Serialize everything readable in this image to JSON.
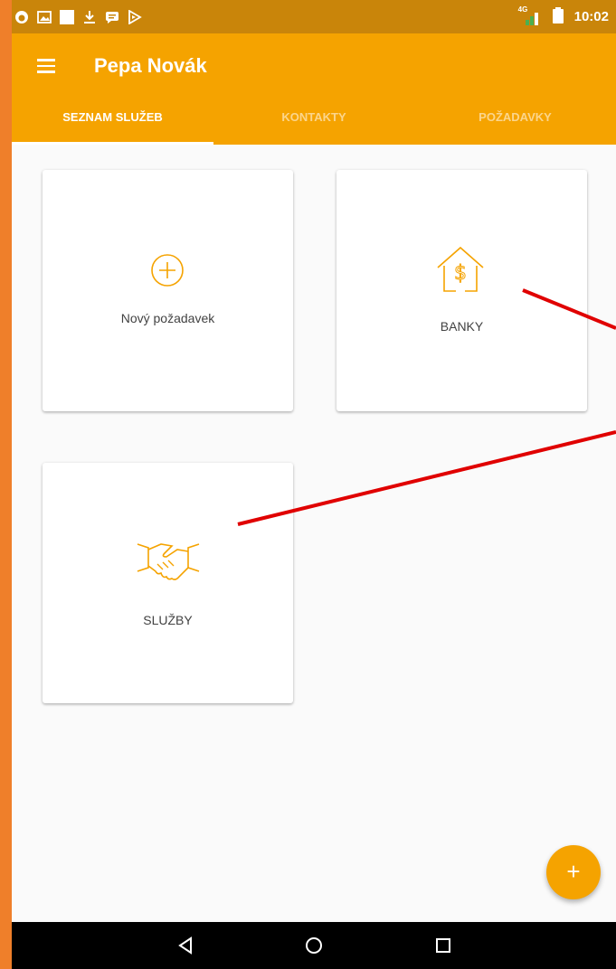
{
  "status_bar": {
    "network": "4G",
    "time": "10:02"
  },
  "app_bar": {
    "title": "Pepa Novák",
    "menu_icon": "hamburger-menu-icon"
  },
  "tabs": [
    {
      "label": "SEZNAM SLUŽEB",
      "active": true
    },
    {
      "label": "KONTAKTY",
      "active": false
    },
    {
      "label": "POŽADAVKY",
      "active": false
    }
  ],
  "cards": [
    {
      "label": "Nový požadavek",
      "icon": "add-circle-icon"
    },
    {
      "label": "BANKY",
      "icon": "bank-house-dollar-icon"
    },
    {
      "label": "SLUŽBY",
      "icon": "handshake-icon"
    }
  ],
  "fab": {
    "label": "+"
  },
  "colors": {
    "primary": "#f5a300",
    "status_bar": "#c9850a",
    "accent_border": "#ef7f2a",
    "icon": "#f5a300",
    "annotation": "#e00000"
  }
}
